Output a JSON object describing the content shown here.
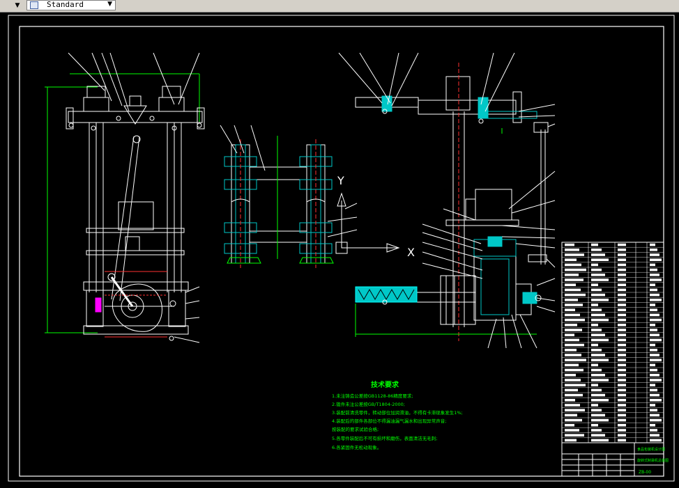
{
  "toolbar": {
    "text_style_value": "Standard",
    "left_dropdown_icon": "chevron-down-icon",
    "style_icon": "text-style-icon",
    "combo_dropdown_icon": "chevron-down-icon"
  },
  "drawing": {
    "section_labels": {
      "y_axis": "Y",
      "x_axis": "X"
    },
    "tech_requirements": {
      "title": "技术要求",
      "items": [
        "1.未注铸造公差按GB1128-86精度要求;",
        "2.锻件未注公差按GB/T1804-2000;",
        "3.装配前清洗零件，转动部位加润滑油，不得有卡滞现象发生1%;",
        "4.装配后的部件各部位不得漏油漏气漏水和出现异常声音;",
        "  按装配的要求试验合格;",
        "5.各零件装配后不可有损坏和磨伤，表面清洁无毛刺;",
        "6.各紧固件无松动现象。"
      ]
    },
    "title_block": {
      "part_name": "食品包装机设计图",
      "subtitle": "旋转式制袋机总装图",
      "drawing_no": "ZB-00"
    },
    "colors": {
      "background": "#000000",
      "outline": "#ffffff",
      "section": "#00c8c8",
      "dimension": "#00ff00",
      "leader_text": "#ffffff",
      "hidden": "#ff3030",
      "highlight": "#ff00ff"
    }
  }
}
